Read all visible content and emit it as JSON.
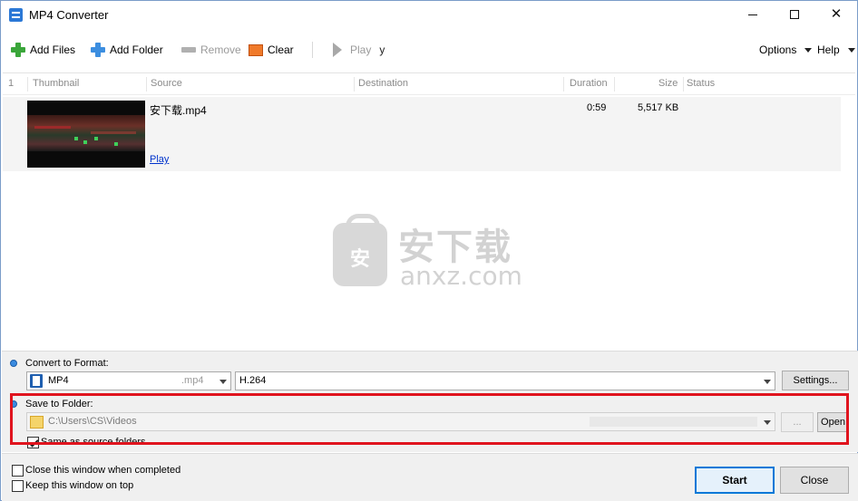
{
  "window": {
    "title": "MP4 Converter",
    "minimize_symbol": "—",
    "close_symbol": "✕"
  },
  "toolbar": {
    "add_files": "Add Files",
    "add_folder": "Add Folder",
    "remove": "Remove",
    "clear": "Clear",
    "play": "Play",
    "play_suffix": "y",
    "options": "Options",
    "help": "Help"
  },
  "list": {
    "columns": {
      "index": "1",
      "thumbnail": "Thumbnail",
      "source": "Source",
      "destination": "Destination",
      "duration": "Duration",
      "size": "Size",
      "status": "Status"
    },
    "rows": [
      {
        "source": "安下载.mp4",
        "play_link": "Play",
        "duration": "0:59",
        "size": "5,517 KB",
        "status": ""
      }
    ]
  },
  "watermark": {
    "title": "安下载",
    "subtitle": "anxz.com",
    "bag_char": "安"
  },
  "convert": {
    "label": "Convert to Format:",
    "format_name": "MP4",
    "format_ext": ".mp4",
    "codec": "H.264",
    "settings_button": "Settings..."
  },
  "save": {
    "label": "Save to Folder:",
    "path": "C:\\Users\\CS\\Videos",
    "browse_button": "...",
    "open_button": "Open",
    "same_as_source_label": "Same as source folders",
    "same_as_source_checked": true
  },
  "footer": {
    "close_when_completed": "Close this window when completed",
    "close_when_completed_checked": false,
    "keep_on_top": "Keep this window on top",
    "keep_on_top_checked": false,
    "start_button": "Start",
    "close_button": "Close"
  },
  "colors": {
    "accent": "#0078d7",
    "highlight": "#e0141e",
    "link": "#0033cc"
  }
}
